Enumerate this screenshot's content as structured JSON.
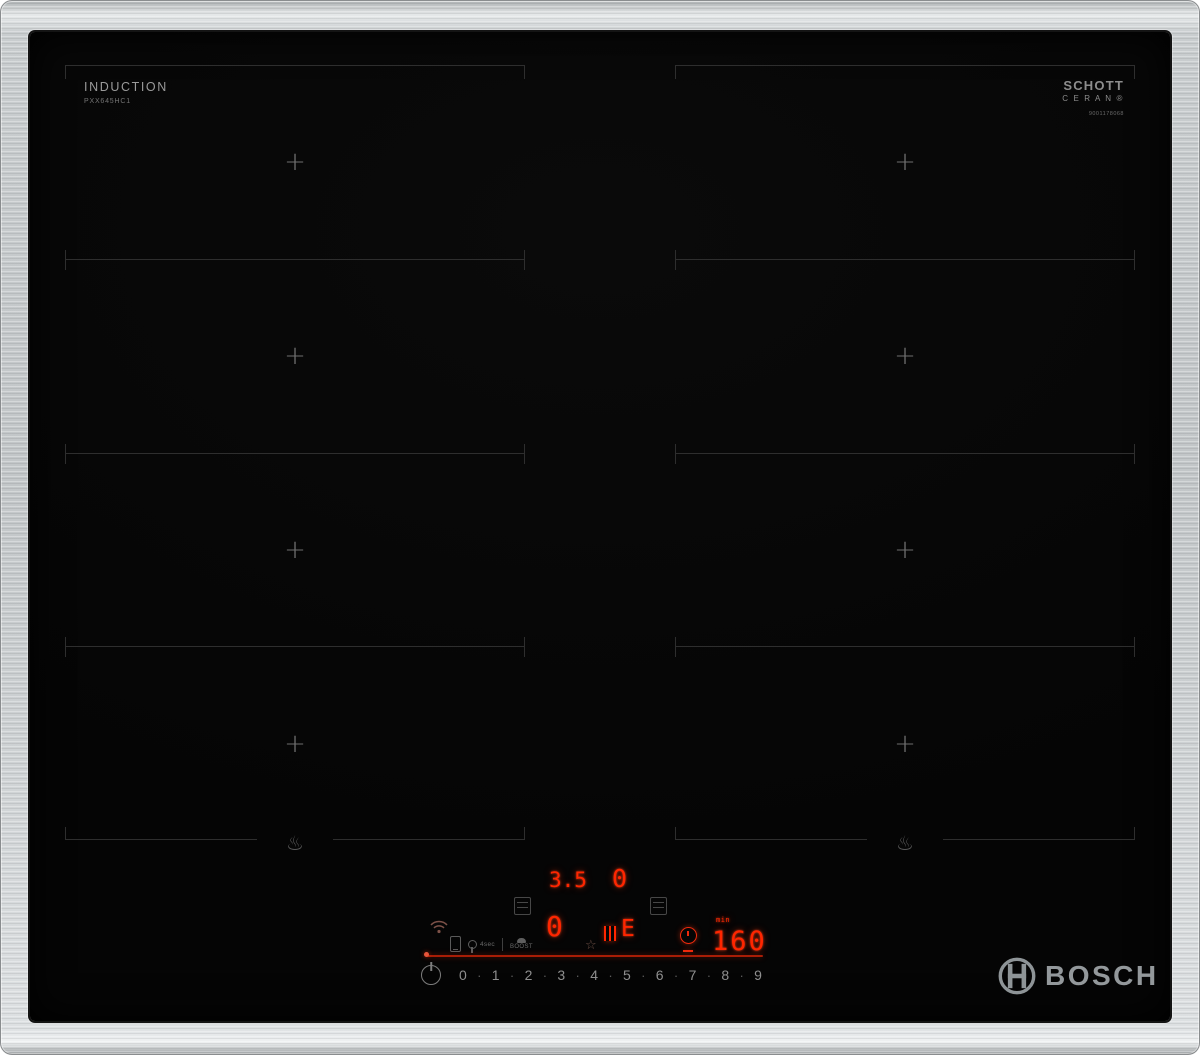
{
  "branding": {
    "induction_label": "INDUCTION",
    "model_number": "PXX645HC1",
    "schott_line1": "SCHOTT",
    "schott_line2": "C E R A N ®",
    "schott_serial": "9001178068",
    "bosch_label": "BOSCH"
  },
  "zones": {
    "plus_marker": "+",
    "steam_icon": "♨"
  },
  "panel": {
    "lock_label": "4sec",
    "boost_label": "BOOST",
    "star_icon": "☆",
    "displays": {
      "timer_value": "3.5",
      "zone_value_top": "0",
      "zone_value_left": "0",
      "pan_indicator": "E",
      "unit_min": "min",
      "timer_main": "160"
    },
    "slider_items": [
      "0",
      "·",
      "1",
      "·",
      "2",
      "·",
      "3",
      "·",
      "4",
      "·",
      "5",
      "·",
      "6",
      "·",
      "7",
      "·",
      "8",
      "·",
      "9"
    ]
  },
  "colors": {
    "led_red": "#ff2600",
    "steel": "#ccd0d2",
    "glass": "#060606",
    "zone_outline": "#2e2e2e"
  }
}
